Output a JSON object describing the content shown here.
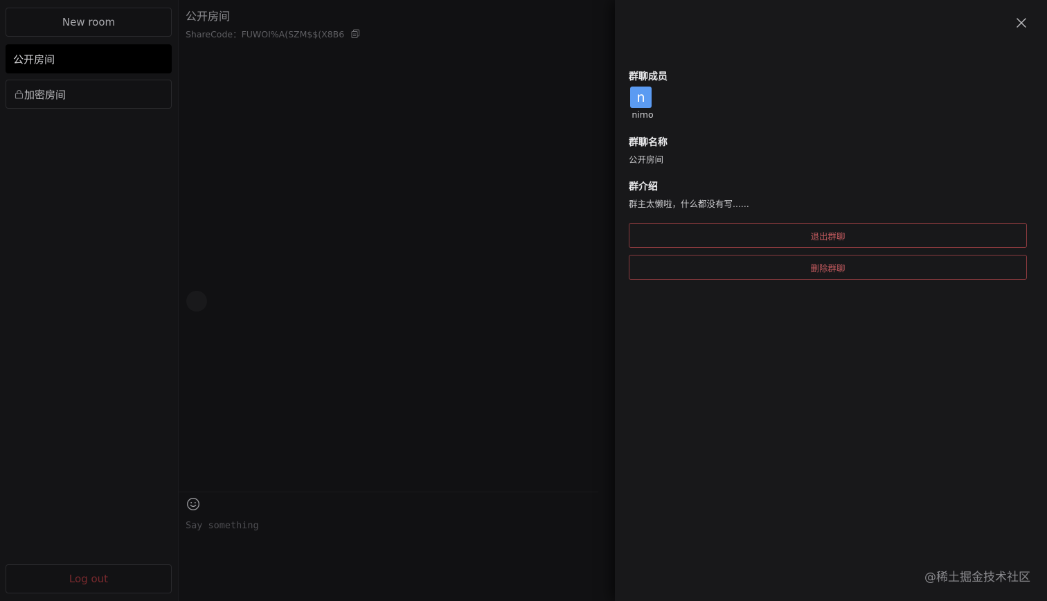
{
  "sidebar": {
    "new_room_label": "New room",
    "rooms": [
      {
        "label": "公开房间",
        "locked": false
      },
      {
        "label": "加密房间",
        "locked": true
      }
    ],
    "logout_label": "Log out"
  },
  "chat": {
    "room_title": "公开房间",
    "share_code": "ShareCode：FUWOI%A(SZM$$(X8B6",
    "input_placeholder": "Say something"
  },
  "drawer": {
    "members_title": "群聊成员",
    "members": [
      {
        "initial": "n",
        "name": "nimo",
        "color": "#5b9bf2"
      }
    ],
    "name_title": "群聊名称",
    "name_value": "公开房间",
    "intro_title": "群介绍",
    "intro_value": "群主太懒啦，什么都没有写......",
    "leave_label": "退出群聊",
    "delete_label": "删除群聊"
  },
  "watermark": "@稀土掘金技术社区",
  "colors": {
    "accent_danger": "#c25a5e",
    "avatar_blue": "#5b9bf2",
    "logout_red": "#7a2a2e"
  },
  "icons": [
    "lock-icon",
    "copy-icon",
    "emoji-icon",
    "close-icon"
  ]
}
